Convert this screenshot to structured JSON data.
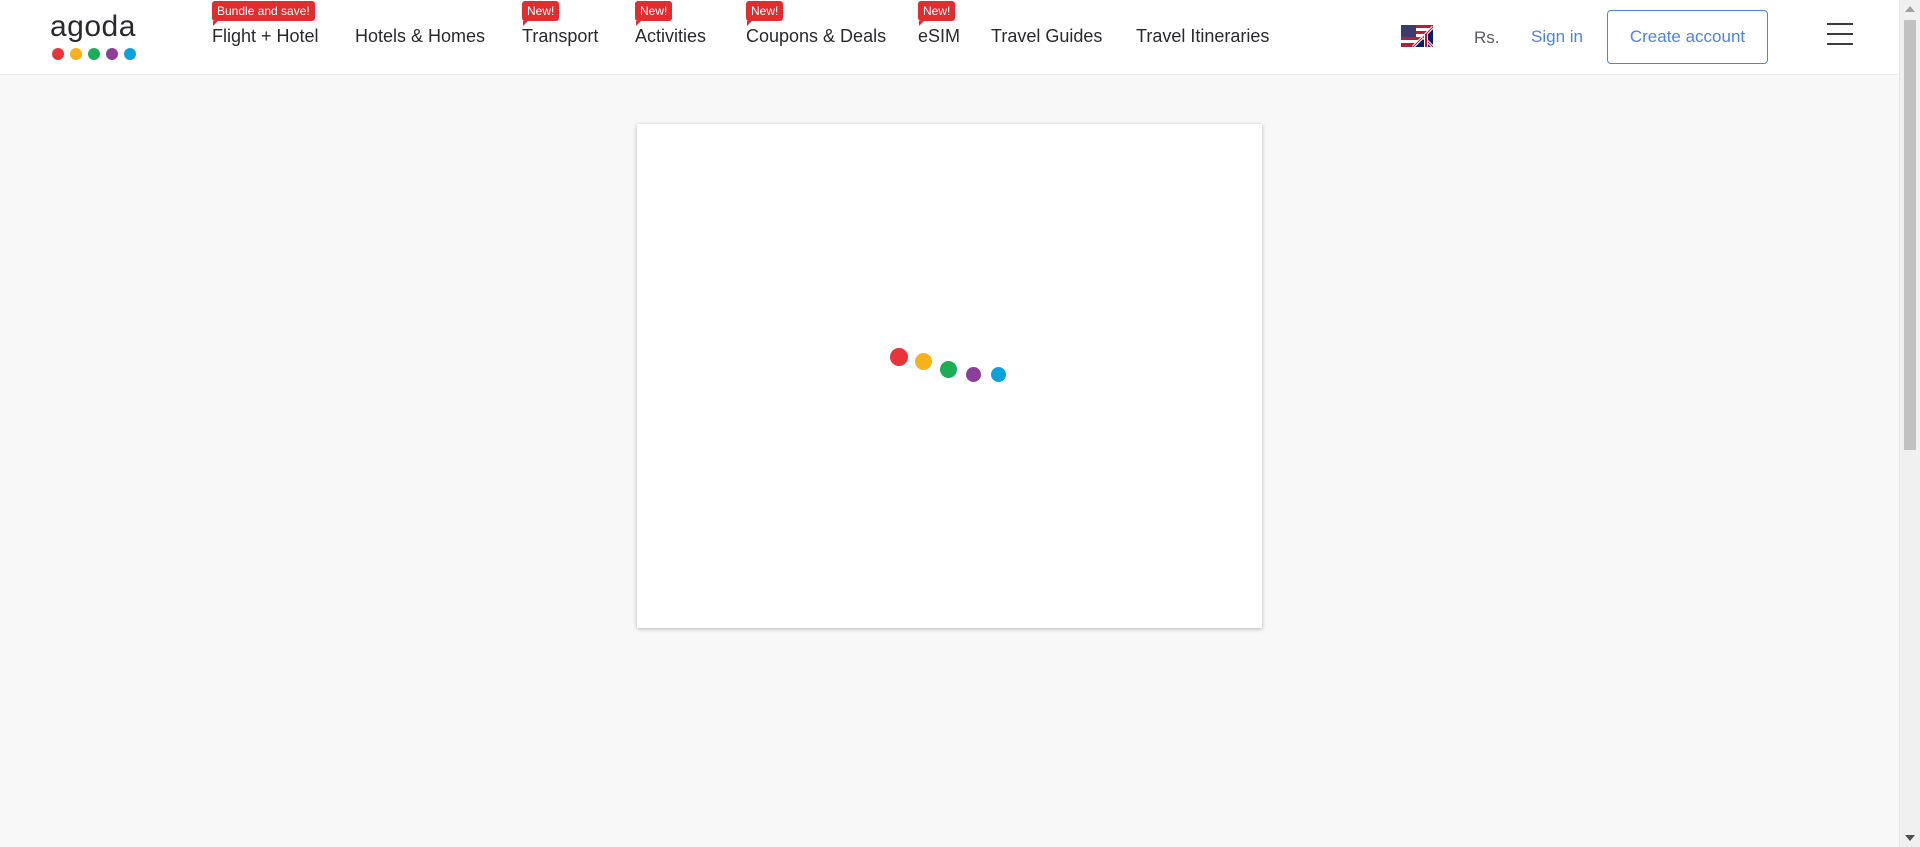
{
  "brand": {
    "logo_text": "agoda",
    "logo_dot_colors": [
      "#e8343a",
      "#f7b21b",
      "#1bae54",
      "#8d3d9a",
      "#0ba2dc"
    ]
  },
  "nav": {
    "items": [
      {
        "label": "Flight + Hotel",
        "badge": "Bundle and save!"
      },
      {
        "label": "Hotels & Homes",
        "badge": ""
      },
      {
        "label": "Transport",
        "badge": "New!"
      },
      {
        "label": "Activities",
        "badge": "New!"
      },
      {
        "label": "Coupons & Deals",
        "badge": "New!"
      },
      {
        "label": "eSIM",
        "badge": "New!"
      },
      {
        "label": "Travel Guides",
        "badge": ""
      },
      {
        "label": "Travel Itineraries",
        "badge": ""
      }
    ],
    "badge_color": "#e12d2d"
  },
  "account": {
    "language_icon": "uk-flag-icon",
    "currency": "Rs.",
    "signin_label": "Sign in",
    "create_account_label": "Create account",
    "accent_color": "#4a84e0",
    "menu_icon": "hamburger-menu-icon"
  },
  "loader": {
    "icon": "loading-dots-icon",
    "dot_colors": [
      "#e8343a",
      "#f7b21b",
      "#1bae54",
      "#8d3d9a",
      "#0ba2dc"
    ]
  }
}
